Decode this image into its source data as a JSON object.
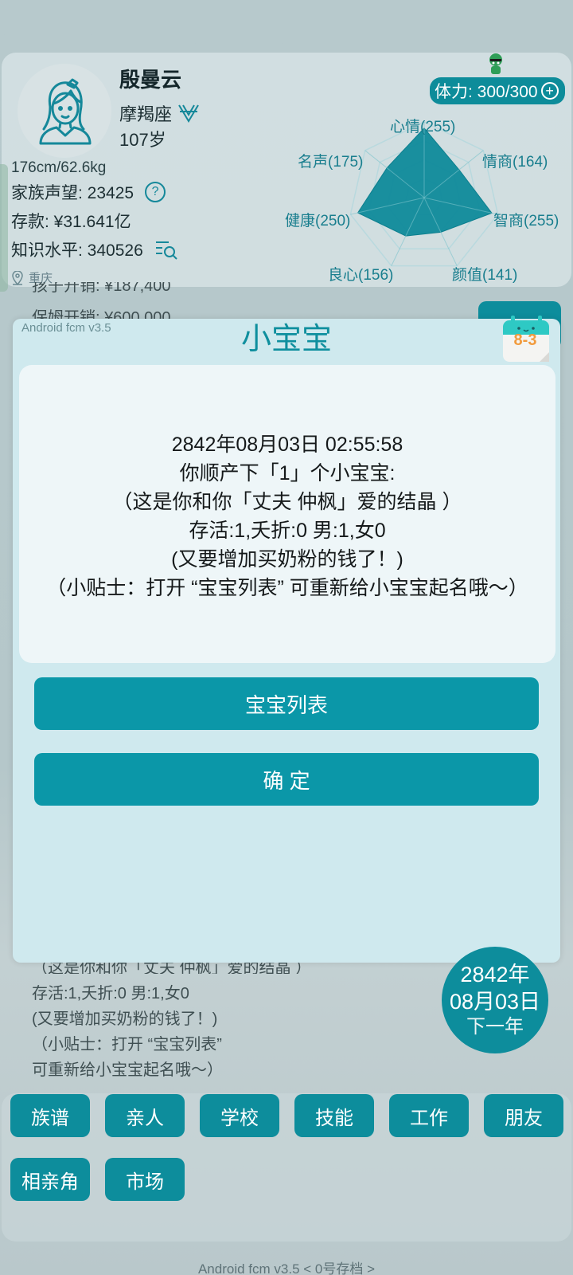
{
  "profile": {
    "name": "殷曼云",
    "zodiac": "摩羯座",
    "age": "107岁",
    "height_weight": "176cm/62.6kg",
    "family_prestige": "家族声望: 23425",
    "savings": "存款: ¥31.641亿",
    "knowledge": "知识水平: 340526",
    "location": "重庆"
  },
  "stamina": {
    "label": "体力: 300/300"
  },
  "radar": {
    "labels": {
      "mood": "心情(255)",
      "eq": "情商(164)",
      "iq": "智商(255)",
      "looks": "颜值(141)",
      "conscience": "良心(156)",
      "health": "健康(250)",
      "fame": "名声(175)"
    },
    "values": [
      255,
      164,
      255,
      141,
      156,
      250,
      175
    ],
    "max": 300
  },
  "background": {
    "line_top_1": "孩子开销: ¥187,400",
    "line_top_2": "保姆开销: ¥600,000",
    "line_b1": "（这是你和你「丈夫 仲枫」爱的结晶 ）",
    "line_b2": "存活:1,夭折:0  男:1,女0",
    "line_b3": "(又要增加买奶粉的钱了！)",
    "line_b4": "（小贴士：打开 “宝宝列表”",
    "line_b5": "可重新给小宝宝起名哦～）"
  },
  "modal": {
    "version": "Android fcm v3.5",
    "title": "小宝宝",
    "calendar": "8-3",
    "lines": [
      "2842年08月03日 02:55:58",
      "你顺产下「1」个小宝宝:",
      "（这是你和你「丈夫 仲枫」爱的结晶 ）",
      "存活:1,夭折:0  男:1,女0",
      "(又要增加买奶粉的钱了！)",
      "（小贴士：打开 “宝宝列表” 可重新给小宝宝起名哦～）"
    ],
    "btn_list": "宝宝列表",
    "btn_ok": "确  定"
  },
  "date_circle": {
    "year": "2842年",
    "month_day": "08月03日",
    "next": "下一年"
  },
  "grid": {
    "row1": [
      "族谱",
      "亲人",
      "学校",
      "技能",
      "工作",
      "朋友"
    ],
    "row2": [
      "相亲角",
      "市场"
    ]
  },
  "footer": "Android fcm v3.5  < 0号存档 >",
  "colors": {
    "accent": "#0d8d9c",
    "title": "#0f8f9e",
    "radar": "#197e8e"
  }
}
